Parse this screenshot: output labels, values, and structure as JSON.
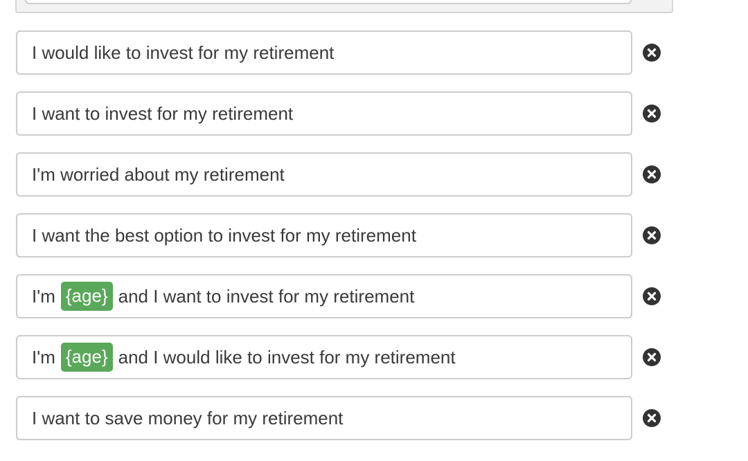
{
  "colors": {
    "tag_background": "#5aa85a",
    "text": "#3a3a3a",
    "border": "#cccccc",
    "remove_icon": "#333333"
  },
  "rows": [
    {
      "segments": [
        {
          "type": "text",
          "value": "I would like to invest for my retirement"
        }
      ],
      "remove_icon": "close-circle-icon"
    },
    {
      "segments": [
        {
          "type": "text",
          "value": "I want to invest for my retirement"
        }
      ],
      "remove_icon": "close-circle-icon"
    },
    {
      "segments": [
        {
          "type": "text",
          "value": "I'm worried about my retirement"
        }
      ],
      "remove_icon": "close-circle-icon"
    },
    {
      "segments": [
        {
          "type": "text",
          "value": "I want the best option to invest for my retirement"
        }
      ],
      "remove_icon": "close-circle-icon"
    },
    {
      "segments": [
        {
          "type": "text",
          "value": "I'm"
        },
        {
          "type": "tag",
          "value": "{age}"
        },
        {
          "type": "text",
          "value": "and I want to invest for my retirement"
        }
      ],
      "remove_icon": "close-circle-icon"
    },
    {
      "segments": [
        {
          "type": "text",
          "value": "I'm"
        },
        {
          "type": "tag",
          "value": "{age}"
        },
        {
          "type": "text",
          "value": "and I would like to invest for my retirement"
        }
      ],
      "remove_icon": "close-circle-icon"
    },
    {
      "segments": [
        {
          "type": "text",
          "value": "I want to save money for my retirement"
        }
      ],
      "remove_icon": "close-circle-icon"
    }
  ]
}
